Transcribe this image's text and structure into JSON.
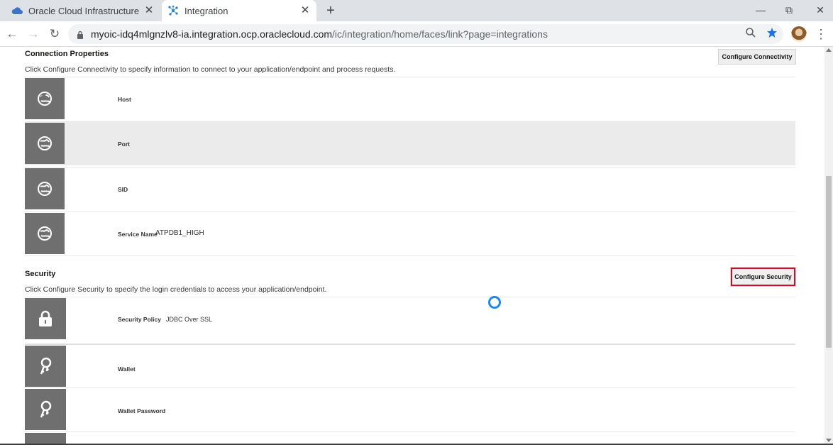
{
  "browser": {
    "tabs": [
      {
        "title": "Oracle Cloud Infrastructure",
        "favicon": "cloud-icon",
        "active": false
      },
      {
        "title": "Integration",
        "favicon": "integration-icon",
        "active": true
      }
    ],
    "new_tab": "+",
    "window_controls": {
      "minimize": "—",
      "restore": "⧉",
      "close": "✕"
    },
    "url": {
      "host": "myoic-idq4mlgnzlv8-ia.integration.ocp.oraclecloud.com",
      "path": "/ic/integration/home/faces/link?page=integrations"
    },
    "accent_color": "#1a73e8"
  },
  "connection": {
    "title": "Connection Properties",
    "description": "Click Configure Connectivity to specify information to connect to your application/endpoint and process requests.",
    "button": "Configure Connectivity",
    "rows": [
      {
        "label": "Host",
        "value": "",
        "icon": "globe-refresh-icon"
      },
      {
        "label": "Port",
        "value": "",
        "icon": "globe-refresh-icon"
      },
      {
        "label": "SID",
        "value": "",
        "icon": "globe-refresh-icon"
      },
      {
        "label": "Service Name",
        "value": "ATPDB1_HIGH",
        "icon": "globe-refresh-icon"
      }
    ]
  },
  "security": {
    "title": "Security",
    "description": "Click Configure Security to specify the login credentials to access your application/endpoint.",
    "button": "Configure Security",
    "button_highlight_color": "#c8102e",
    "rows": [
      {
        "label": "Security Policy",
        "value": "JDBC Over SSL",
        "icon": "lock-icon"
      },
      {
        "label": "Wallet",
        "value": "",
        "icon": "key-icon"
      },
      {
        "label": "Wallet Password",
        "value": "",
        "icon": "key-icon"
      }
    ]
  },
  "loading_spinner": {
    "color": "#1e88e5"
  }
}
